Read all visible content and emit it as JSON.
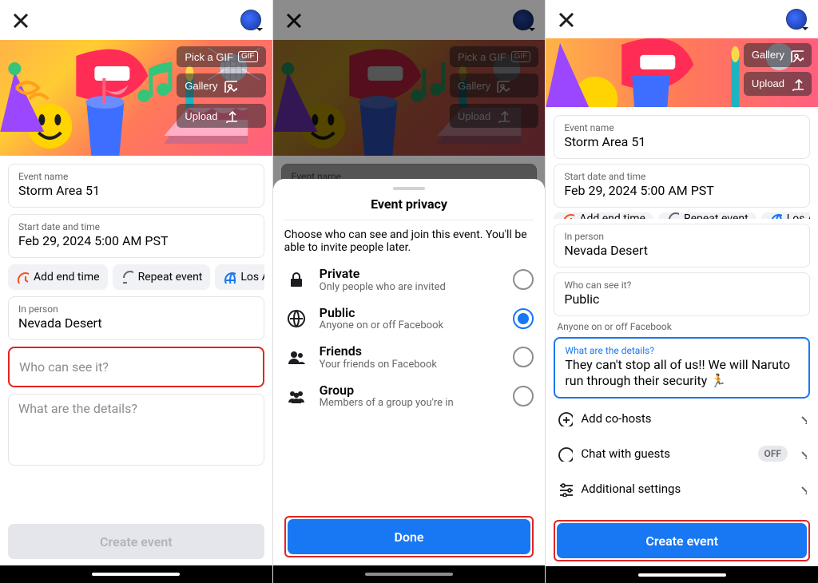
{
  "banner_buttons": {
    "pick_gif": "Pick a GIF",
    "gallery": "Gallery",
    "upload": "Upload"
  },
  "fields": {
    "event_name_label": "Event name",
    "event_name_value": "Storm Area 51",
    "start_label": "Start date and time",
    "start_value": "Feb 29, 2024 5:00 AM PST",
    "location_label": "In person",
    "location_value": "Nevada Desert",
    "who_placeholder": "Who can see it?",
    "who_label": "Who can see it?",
    "who_value": "Public",
    "who_hint": "Anyone on or off Facebook",
    "details_placeholder": "What are the details?",
    "details_label": "What are the details?",
    "details_value": "They can't stop all of us!! We will Naruto run through their security 🏃"
  },
  "chips": {
    "add_end": "Add end time",
    "repeat": "Repeat event",
    "location_partial": "Los Angele"
  },
  "rows": {
    "cohosts": "Add co-hosts",
    "chat": "Chat with guests",
    "chat_state": "OFF",
    "additional": "Additional settings"
  },
  "buttons": {
    "create_event": "Create event",
    "done": "Done"
  },
  "sheet": {
    "title": "Event privacy",
    "desc": "Choose who can see and join this event. You'll be able to invite people later.",
    "options": [
      {
        "title": "Private",
        "subtitle": "Only people who are invited"
      },
      {
        "title": "Public",
        "subtitle": "Anyone on or off Facebook"
      },
      {
        "title": "Friends",
        "subtitle": "Your friends on Facebook"
      },
      {
        "title": "Group",
        "subtitle": "Members of a group you're in"
      }
    ],
    "selected_index": 1
  }
}
